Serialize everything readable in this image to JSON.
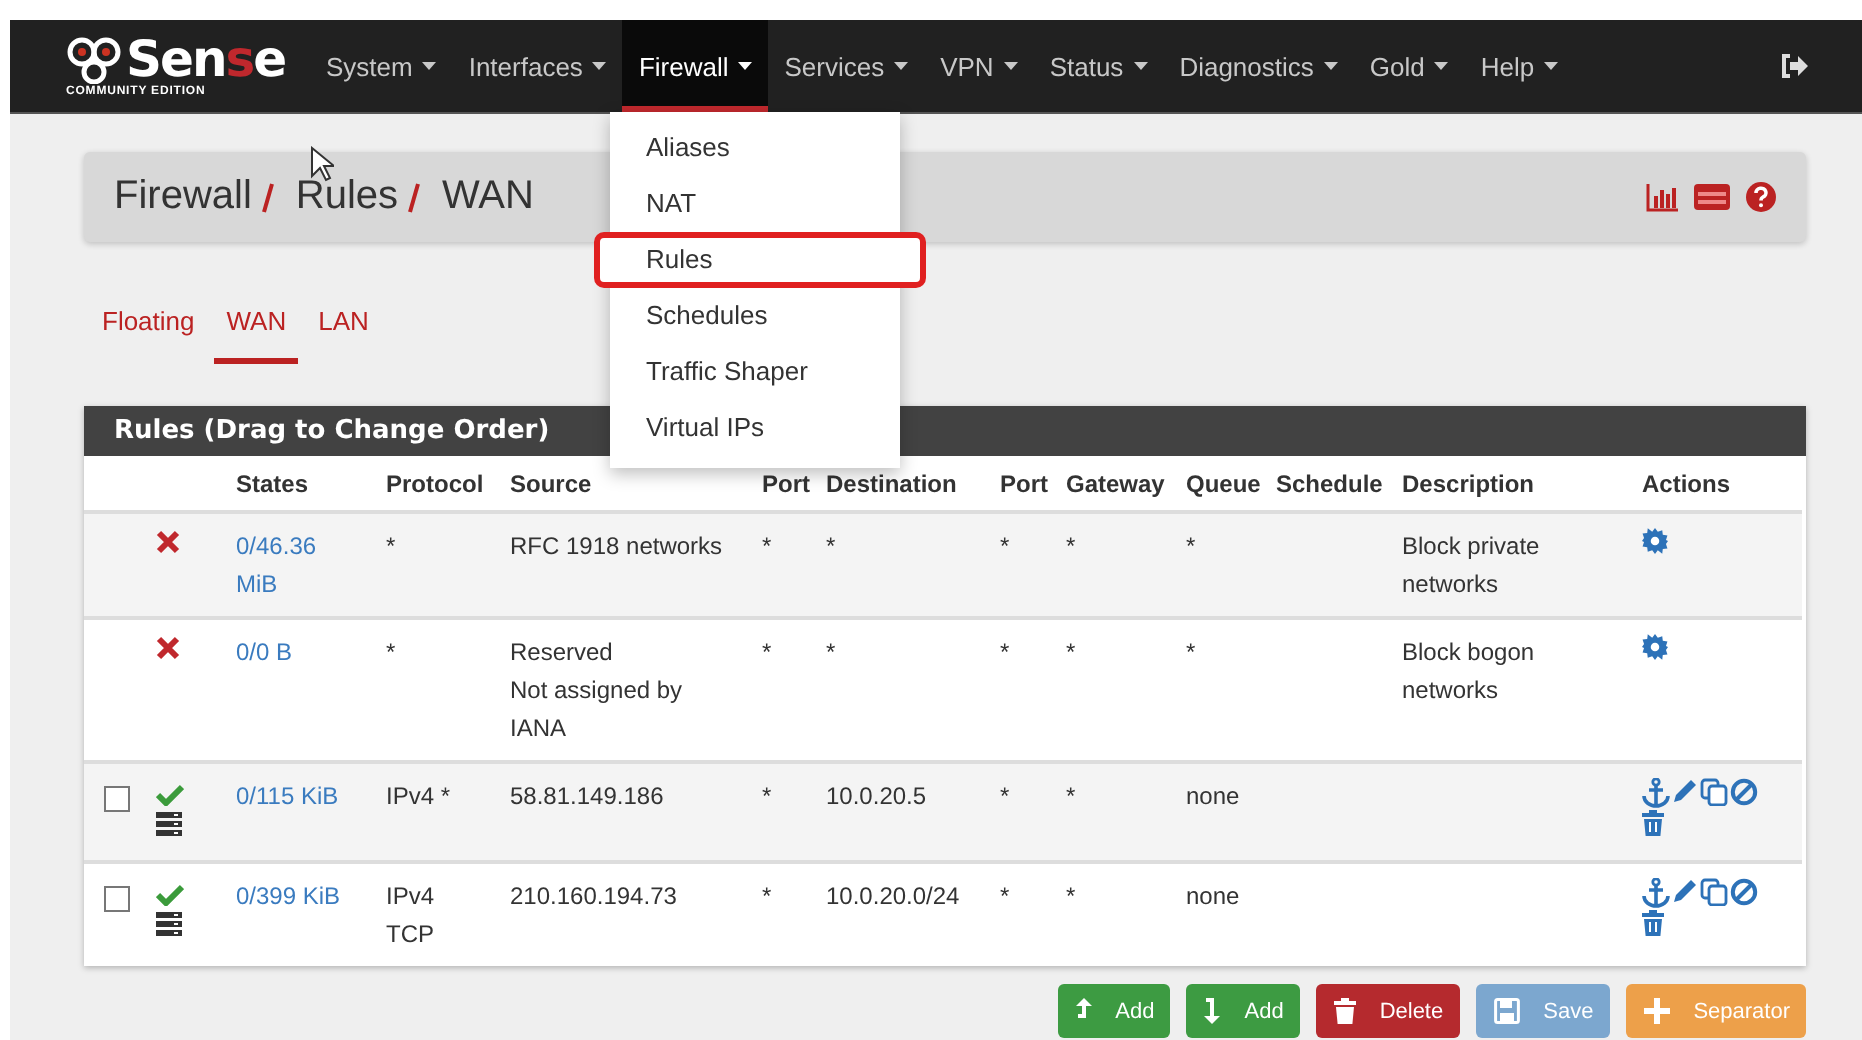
{
  "navbar": {
    "logo": {
      "parts": [
        {
          "text": "Sen",
          "accent": false
        },
        {
          "text": "s",
          "accent": true
        },
        {
          "text": "e",
          "accent": false
        }
      ],
      "subtitle": "COMMUNITY EDITION"
    },
    "menus": [
      {
        "label": "System",
        "selected": false
      },
      {
        "label": "Interfaces",
        "selected": false
      },
      {
        "label": "Firewall",
        "selected": true
      },
      {
        "label": "Services",
        "selected": false
      },
      {
        "label": "VPN",
        "selected": false
      },
      {
        "label": "Status",
        "selected": false
      },
      {
        "label": "Diagnostics",
        "selected": false
      },
      {
        "label": "Gold",
        "selected": false
      },
      {
        "label": "Help",
        "selected": false
      }
    ]
  },
  "dropdown": {
    "items": [
      {
        "label": "Aliases",
        "highlighted": false
      },
      {
        "label": "NAT",
        "highlighted": false
      },
      {
        "label": "Rules",
        "highlighted": true
      },
      {
        "label": "Schedules",
        "highlighted": false
      },
      {
        "label": "Traffic Shaper",
        "highlighted": false
      },
      {
        "label": "Virtual IPs",
        "highlighted": false
      }
    ]
  },
  "breadcrumb": [
    "Firewall",
    "Rules",
    "WAN"
  ],
  "tabs": [
    {
      "label": "Floating",
      "selected": false
    },
    {
      "label": "WAN",
      "selected": true
    },
    {
      "label": "LAN",
      "selected": false
    }
  ],
  "table": {
    "title": "Rules (Drag to Change Order)",
    "columns": [
      "States",
      "Protocol",
      "Source",
      "Port",
      "Destination",
      "Port",
      "Gateway",
      "Queue",
      "Schedule",
      "Description",
      "Actions"
    ],
    "rows": [
      {
        "kind": "block",
        "states": "0/46.36 MiB",
        "protocol": "*",
        "source": [
          "RFC 1918 networks"
        ],
        "port": "*",
        "destination": "*",
        "dest_port": "*",
        "gateway": "*",
        "queue": "*",
        "description": "Block private networks"
      },
      {
        "kind": "block",
        "states": "0/0 B",
        "protocol": "*",
        "source": [
          "Reserved",
          "Not assigned by IANA"
        ],
        "port": "*",
        "destination": "*",
        "dest_port": "*",
        "gateway": "*",
        "queue": "*",
        "description": "Block bogon networks"
      },
      {
        "kind": "pass",
        "checked": false,
        "states": "0/115 KiB",
        "protocol": "IPv4 *",
        "source": [
          "58.81.149.186"
        ],
        "port": "*",
        "destination": "10.0.20.5",
        "dest_port": "*",
        "gateway": "*",
        "queue": "none"
      },
      {
        "kind": "pass",
        "checked": false,
        "states": "0/399 KiB",
        "protocol": "IPv4 TCP",
        "source": [
          "210.160.194.73"
        ],
        "port": "*",
        "destination": "10.0.20.0/24",
        "dest_port": "*",
        "gateway": "*",
        "queue": "none"
      }
    ]
  },
  "buttons": [
    {
      "label": "Add",
      "kind": "add-top",
      "color": "#3d9b42"
    },
    {
      "label": "Add",
      "kind": "add-bottom",
      "color": "#3d9b42"
    },
    {
      "label": "Delete",
      "kind": "delete",
      "color": "#b52a2e"
    },
    {
      "label": "Save",
      "kind": "save",
      "color": "#7ca7cf"
    },
    {
      "label": "Separator",
      "kind": "separator",
      "color": "#eda04a"
    }
  ]
}
